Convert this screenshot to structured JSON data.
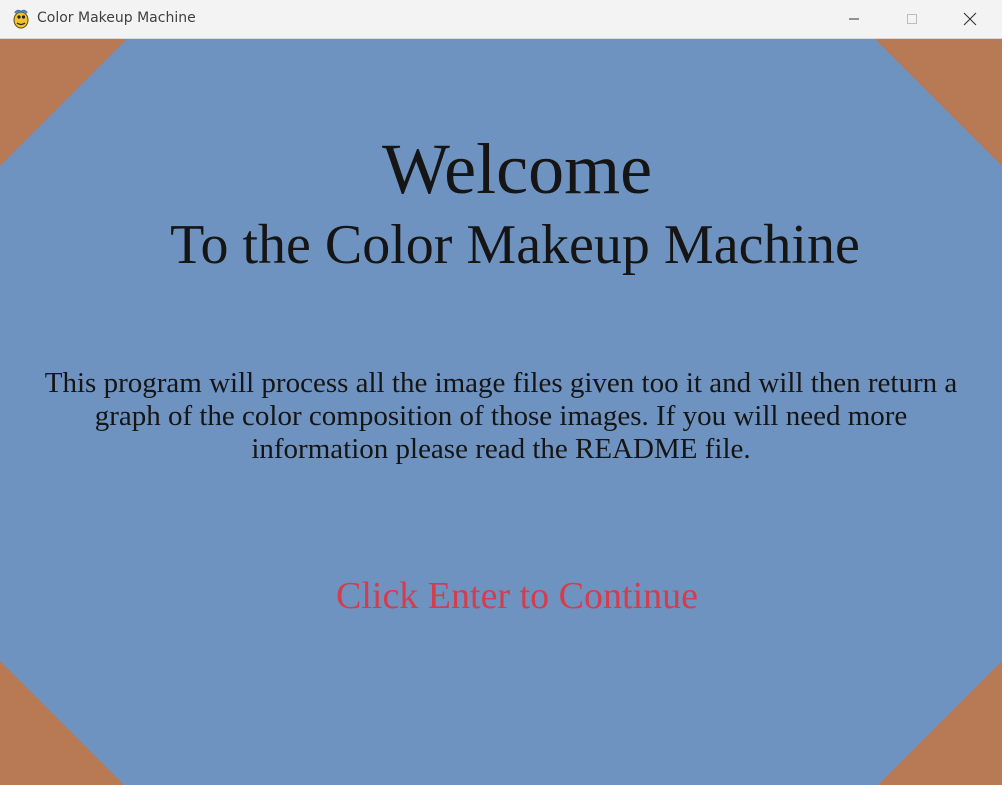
{
  "window": {
    "title": "Color Makeup Machine",
    "icon": "pygame-snake-icon"
  },
  "colors": {
    "background": "#6f93c0",
    "corners": "#b87a55",
    "text": "#151515",
    "cta": "#d43d4d"
  },
  "content": {
    "heading": "Welcome",
    "subheading": "To the Color Makeup Machine",
    "description_lines": [
      "This program will process all the image files given too it and will then return a",
      "graph of the color composition of those images. If you will need more",
      "information please read the README file."
    ],
    "cta": "Click Enter to Continue"
  }
}
